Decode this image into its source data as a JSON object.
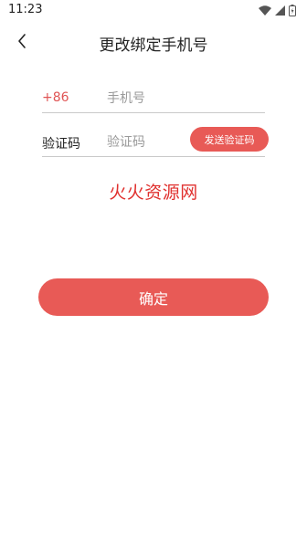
{
  "status_bar": {
    "time": "11:23",
    "icons": [
      "wifi-icon",
      "signal-icon",
      "battery-icon"
    ]
  },
  "app_bar": {
    "back_icon": "back-arrow-icon",
    "title": "更改绑定手机号"
  },
  "phone_row": {
    "country_code": "+86",
    "placeholder": "手机号",
    "value": ""
  },
  "code_row": {
    "label": "验证码",
    "placeholder": "验证码",
    "value": "",
    "send_button_label": "发送验证码"
  },
  "watermark_text": "火火资源网",
  "confirm_label": "确定",
  "colors": {
    "accent": "#e85a56",
    "watermark": "#e0302e",
    "country_code": "#e05454"
  }
}
